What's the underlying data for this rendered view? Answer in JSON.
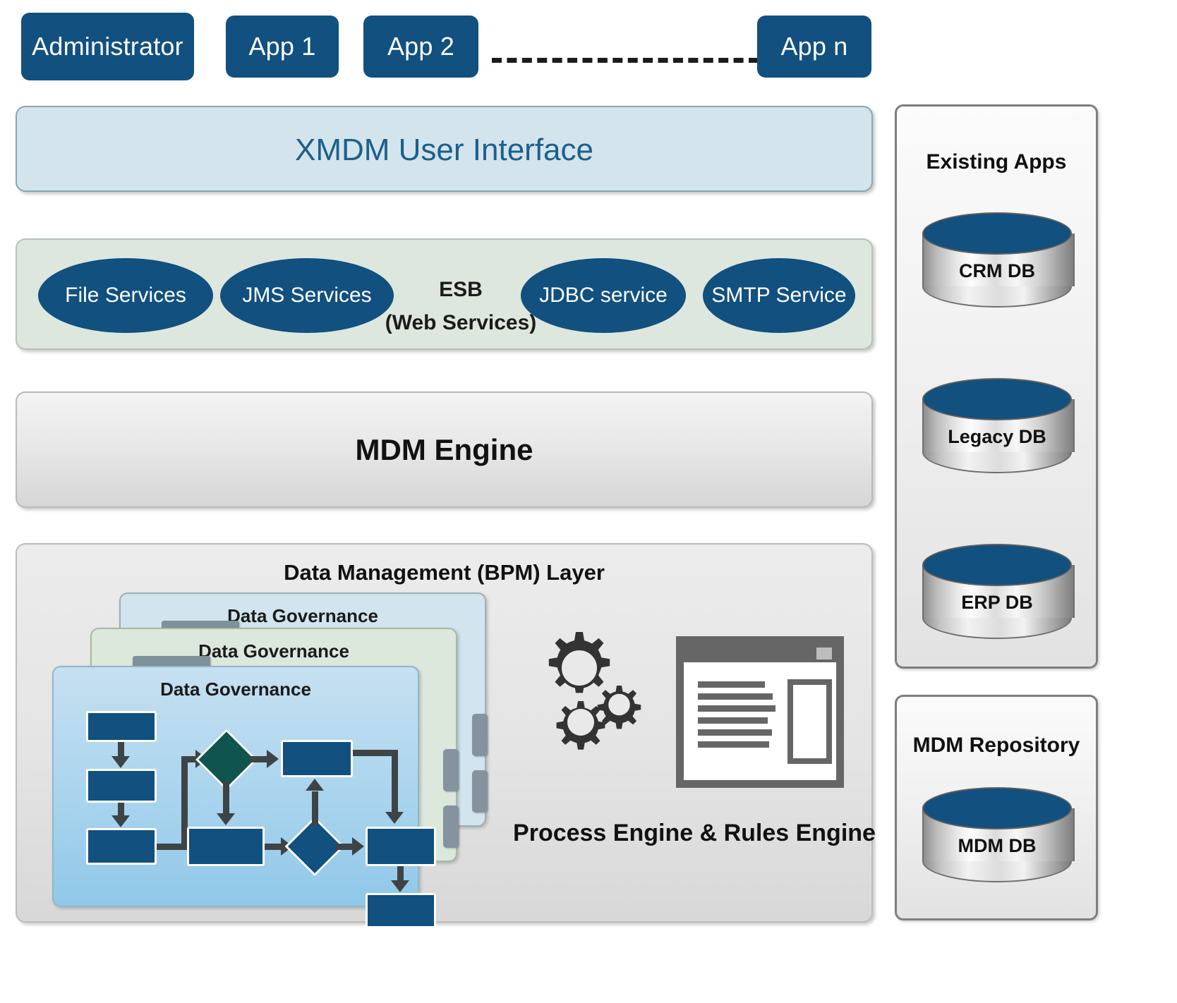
{
  "top_apps": [
    {
      "label": "Administrator"
    },
    {
      "label": "App 1"
    },
    {
      "label": "App 2"
    },
    {
      "label": "App n"
    }
  ],
  "ui_layer": {
    "title": "XMDM User Interface",
    "color": "#1c5f8c",
    "background": "#d3e4ec"
  },
  "esb_layer": {
    "label_line1": "ESB",
    "label_line2": "(Web Services)",
    "background": "#dde7dd",
    "services": [
      {
        "label": "File Services"
      },
      {
        "label": "JMS Services"
      },
      {
        "label": "JDBC service"
      },
      {
        "label": "SMTP Service"
      }
    ]
  },
  "engine_layer": {
    "title": "MDM Engine"
  },
  "bpm_layer": {
    "title": "Data Management (BPM) Layer",
    "governance_cards": [
      {
        "title": "Data Governance"
      },
      {
        "title": "Data Governance"
      },
      {
        "title": "Data Governance"
      }
    ],
    "process_engine_label": "Process Engine & Rules Engine"
  },
  "existing_apps_panel": {
    "title": "Existing Apps",
    "databases": [
      {
        "label": "CRM DB"
      },
      {
        "label": "Legacy DB"
      },
      {
        "label": "ERP DB"
      }
    ]
  },
  "mdm_repository_panel": {
    "title": "MDM Repository",
    "databases": [
      {
        "label": "MDM DB"
      }
    ]
  },
  "icons": {
    "gears": "gears-icon",
    "document": "document-window-icon",
    "database": "database-cylinder-icon"
  },
  "colors": {
    "primary_blue": "#11507f",
    "teal": "#10544f",
    "ui_panel": "#d3e4ec",
    "esb_panel": "#dde7dd",
    "flow_stroke": "#3e4446"
  }
}
